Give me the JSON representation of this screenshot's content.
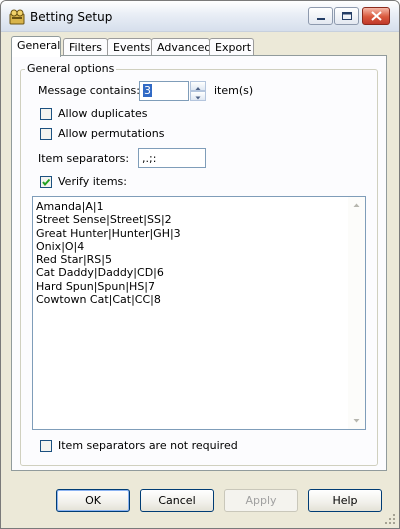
{
  "window": {
    "title": "Betting Setup"
  },
  "tabs": [
    {
      "label": "General",
      "active": true
    },
    {
      "label": "Filters"
    },
    {
      "label": "Events"
    },
    {
      "label": "Advanced"
    },
    {
      "label": "Export"
    }
  ],
  "general": {
    "group_label": "General options",
    "message_contains_label": "Message contains:",
    "message_contains_value": "3",
    "items_suffix": "item(s)",
    "allow_duplicates_label": "Allow duplicates",
    "allow_duplicates_checked": false,
    "allow_permutations_label": "Allow permutations",
    "allow_permutations_checked": false,
    "item_separators_label": "Item separators:",
    "item_separators_value": ",.;:",
    "verify_items_label": "Verify items:",
    "verify_items_checked": true,
    "items_text": "Amanda|A|1\nStreet Sense|Street|SS|2\nGreat Hunter|Hunter|GH|3\nOnix|O|4\nRed Star|RS|5\nCat Daddy|Daddy|CD|6\nHard Spun|Spun|HS|7\nCowtown Cat|Cat|CC|8",
    "separators_not_required_label": "Item separators are not required",
    "separators_not_required_checked": false
  },
  "buttons": {
    "ok": "OK",
    "cancel": "Cancel",
    "apply": "Apply",
    "help": "Help"
  }
}
